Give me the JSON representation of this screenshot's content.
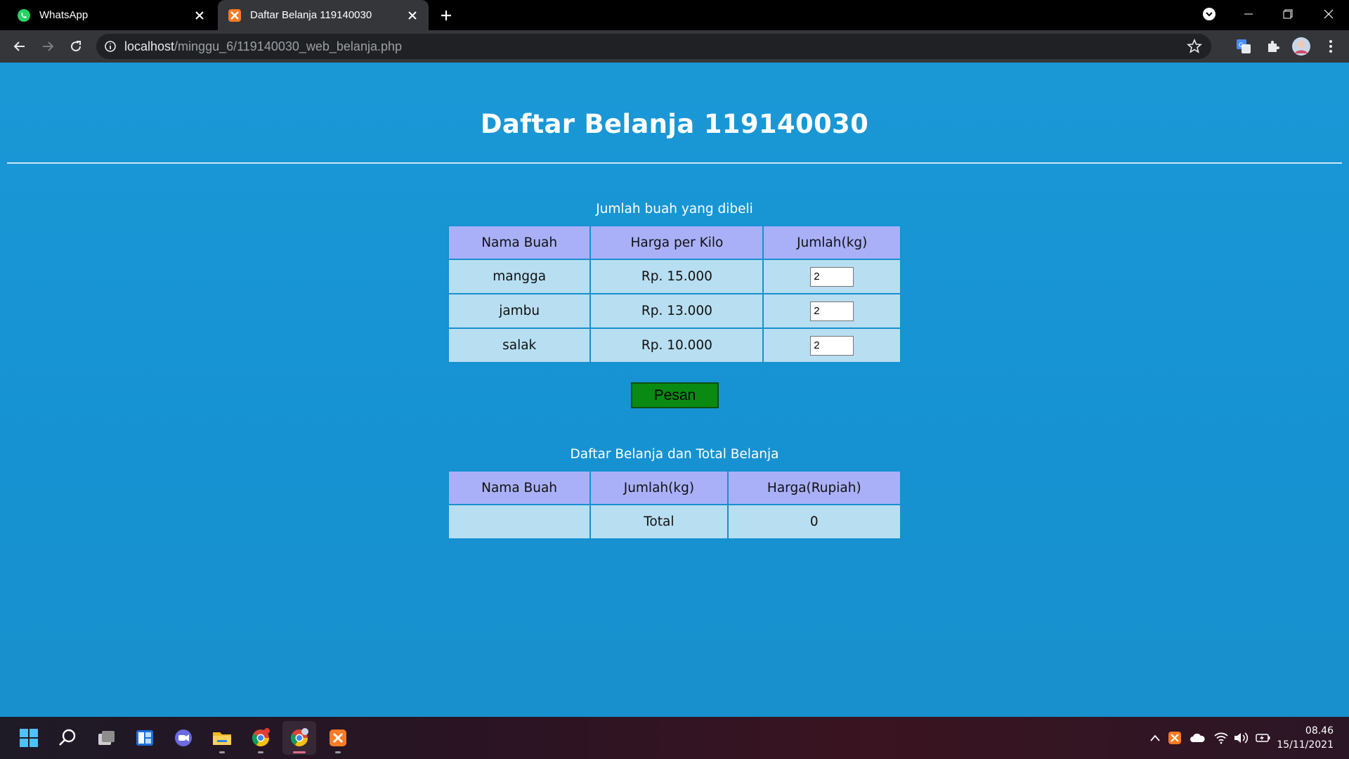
{
  "browser": {
    "tabs": [
      {
        "title": "WhatsApp",
        "active": false
      },
      {
        "title": "Daftar Belanja 119140030",
        "active": true
      }
    ],
    "url_host": "localhost",
    "url_path": "/minggu_6/119140030_web_belanja.php"
  },
  "page": {
    "title": "Daftar Belanja 119140030",
    "form_caption": "Jumlah buah yang dibeli",
    "form_table": {
      "headers": [
        "Nama Buah",
        "Harga per Kilo",
        "Jumlah(kg)"
      ],
      "rows": [
        {
          "name": "mangga",
          "price": "Rp. 15.000",
          "qty": "2"
        },
        {
          "name": "jambu",
          "price": "Rp. 13.000",
          "qty": "2"
        },
        {
          "name": "salak",
          "price": "Rp. 10.000",
          "qty": "2"
        }
      ]
    },
    "submit_label": "Pesan",
    "result_caption": "Daftar Belanja dan Total Belanja",
    "result_table": {
      "headers": [
        "Nama Buah",
        "Jumlah(kg)",
        "Harga(Rupiah)"
      ],
      "total_row": {
        "name": "",
        "label": "Total",
        "value": "0"
      }
    }
  },
  "taskbar": {
    "time": "08.46",
    "date": "15/11/2021"
  },
  "colors": {
    "page_bg": "#1696d4",
    "table_header": "#a9b0f8",
    "table_cell": "#b8def1",
    "button_bg": "#0a8a12"
  }
}
